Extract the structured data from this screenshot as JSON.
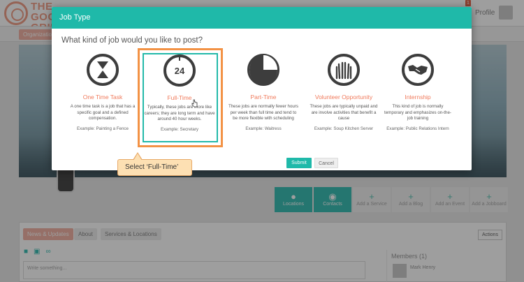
{
  "app": {
    "logo_text": "THE GOOD GRID",
    "profile_label": "Profile",
    "notification_count": "1"
  },
  "subnav": {
    "organizations_label": "Organizations"
  },
  "modal": {
    "title": "Job Type",
    "question": "What kind of job would you like to post?",
    "jobs": [
      {
        "title": "One Time Task",
        "icon": "hourglass-icon",
        "description": "A one time task is a job that has a specific goal and a defined compensation.",
        "example": "Example: Painting a Fence"
      },
      {
        "title": "Full-Time",
        "icon": "clock-24-icon",
        "description": "Typically, these jobs are more like careers; they are long term and have around 40 hour weeks.",
        "example": "Example: Secretary"
      },
      {
        "title": "Part-Time",
        "icon": "pie-clock-icon",
        "description": "These jobs are normally fewer hours per week than full time and tend to be more flexible with scheduling",
        "example": "Example: Waitress"
      },
      {
        "title": "Volunteer Opportunity",
        "icon": "raised-hands-icon",
        "description": "These jobs are typically unpaid and are involve activities that benefit a cause",
        "example": "Example: Soup Kitchen Server"
      },
      {
        "title": "Internship",
        "icon": "handshake-icon",
        "description": "This kind of job is normally temporary and emphasizes on-the-job training",
        "example": "Example: Public Relations Intern"
      }
    ],
    "clock_number": "24",
    "submit_label": "Submit",
    "cancel_label": "Cancel",
    "selected_job": "Full-Time"
  },
  "callout": {
    "text": "Select ‘Full-Time’"
  },
  "actions": [
    {
      "label": "Locations",
      "icon": "map-pin-icon"
    },
    {
      "label": "Contacts",
      "icon": "people-icon"
    },
    {
      "label": "Add a Service",
      "icon": "plus-icon"
    },
    {
      "label": "Add a Blog",
      "icon": "plus-icon"
    },
    {
      "label": "Add an Event",
      "icon": "plus-icon"
    },
    {
      "label": "Add a Jobboard",
      "icon": "plus-icon"
    }
  ],
  "tabs": {
    "news": "News & Updates",
    "about": "About",
    "services": "Services & Locations",
    "actions": "Actions"
  },
  "post": {
    "placeholder": "Write something..."
  },
  "members": {
    "title": "Members (1)",
    "first_member": "Mark Henry"
  },
  "colors": {
    "accent": "#1fb9a9",
    "highlight": "#f39245",
    "job_title": "#f07a5b"
  }
}
